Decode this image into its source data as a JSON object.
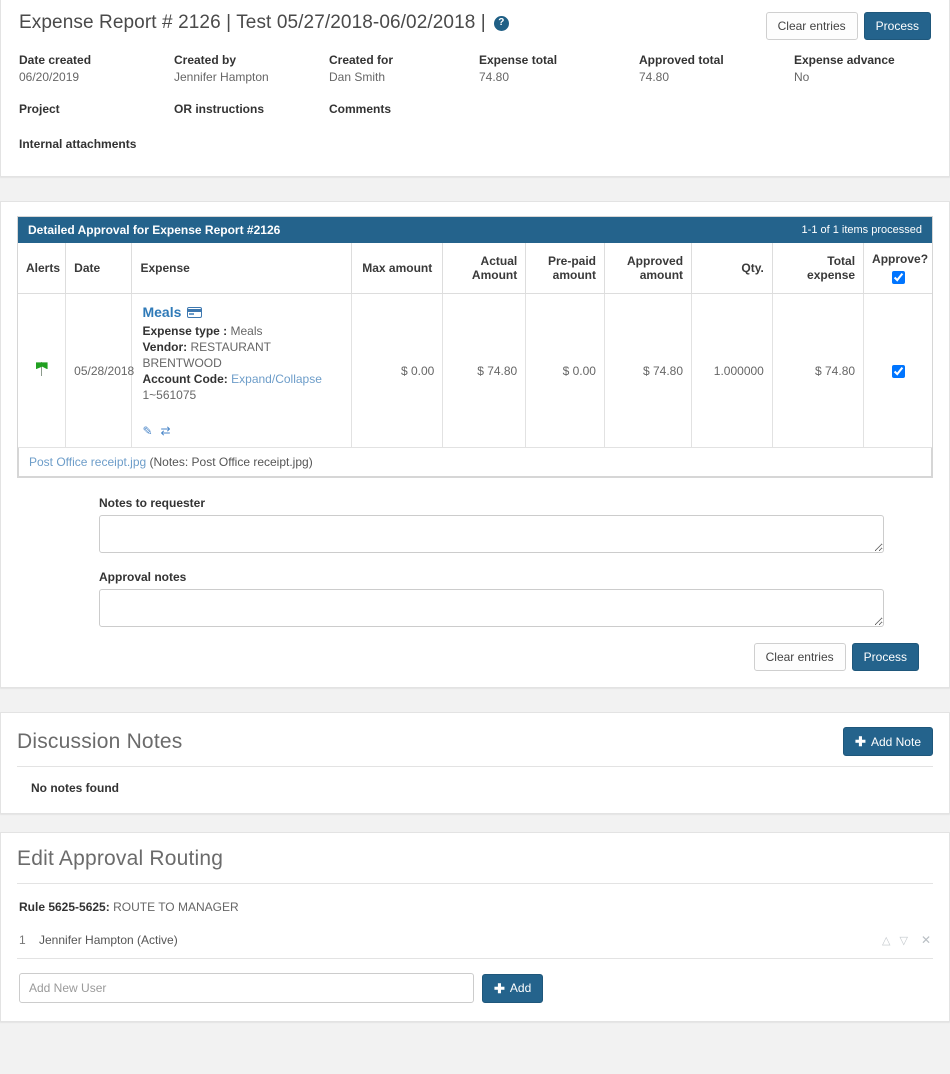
{
  "header": {
    "title": "Expense Report # 2126 | Test 05/27/2018-06/02/2018 |",
    "help_icon": "question-mark-icon",
    "clear_label": "Clear entries",
    "process_label": "Process",
    "meta": [
      {
        "label": "Date created",
        "value": "06/20/2019"
      },
      {
        "label": "Created by",
        "value": "Jennifer Hampton"
      },
      {
        "label": "Created for",
        "value": "Dan Smith"
      },
      {
        "label": "Expense total",
        "value": "74.80"
      },
      {
        "label": "Approved total",
        "value": "74.80"
      },
      {
        "label": "Expense advance",
        "value": "No"
      }
    ],
    "meta_row2": [
      {
        "label": "Project",
        "value": ""
      },
      {
        "label": "OR instructions",
        "value": ""
      },
      {
        "label": "Comments",
        "value": ""
      }
    ],
    "meta_row3": [
      {
        "label": "Internal attachments",
        "value": ""
      }
    ]
  },
  "approval": {
    "caption": "Detailed Approval for Expense Report #2126",
    "count": "1-1 of 1 items processed",
    "columns": [
      "Alerts",
      "Date",
      "Expense",
      "Max amount",
      "Actual Amount",
      "Pre-paid amount",
      "Approved amount",
      "Qty.",
      "Total expense",
      "Approve?"
    ],
    "col_actual_l1": "Actual",
    "col_actual_l2": "Amount",
    "col_pre_l1": "Pre-paid",
    "col_pre_l2": "amount",
    "col_appr_l1": "Approved",
    "col_appr_l2": "amount",
    "row": {
      "alert_icon": "green-flag-icon",
      "date": "05/28/2018",
      "expense_name": "Meals",
      "expense_icon": "credit-card-icon",
      "expense_type_label": "Expense type :",
      "expense_type_value": "Meals",
      "vendor_label": "Vendor:",
      "vendor_value": "RESTAURANT BRENTWOOD",
      "account_code_label": "Account Code:",
      "account_code_link": "Expand/Collapse",
      "account_code_value": "1~561075",
      "edit_icon": "pencil-icon",
      "swap_icon": "shuffle-icon",
      "max_amount": "$ 0.00",
      "actual_amount": "$ 74.80",
      "prepaid_amount": "$ 0.00",
      "approved_amount": "$ 74.80",
      "qty": "1.000000",
      "total_expense": "$ 74.80",
      "approve_checked": true
    },
    "attachment_link": "Post Office receipt.jpg",
    "attachment_note": "(Notes: Post Office receipt.jpg)",
    "notes_to_requester_label": "Notes to requester",
    "notes_to_requester_value": "",
    "approval_notes_label": "Approval notes",
    "approval_notes_value": "",
    "clear_label": "Clear entries",
    "process_label": "Process"
  },
  "discussion": {
    "title": "Discussion Notes",
    "add_note_label": "Add Note",
    "plus_icon": "plus-icon",
    "empty_text": "No notes found"
  },
  "routing": {
    "title": "Edit Approval Routing",
    "rule_label": "Rule 5625-5625:",
    "rule_value": "ROUTE TO MANAGER",
    "entries": [
      {
        "index": "1",
        "name": "Jennifer Hampton (Active)"
      }
    ],
    "up_icon": "chevron-up-icon",
    "down_icon": "chevron-down-icon",
    "remove_icon": "close-icon",
    "add_user_placeholder": "Add New User",
    "add_user_value": "",
    "add_label": "Add",
    "plus_icon": "plus-icon"
  },
  "colors": {
    "primary": "#24638c",
    "caption_bar": "#24638c",
    "link": "#2f7ab8",
    "muted_link": "#6d9dc9",
    "flag_green": "#21a021",
    "page_bg": "#f2f2f2"
  }
}
